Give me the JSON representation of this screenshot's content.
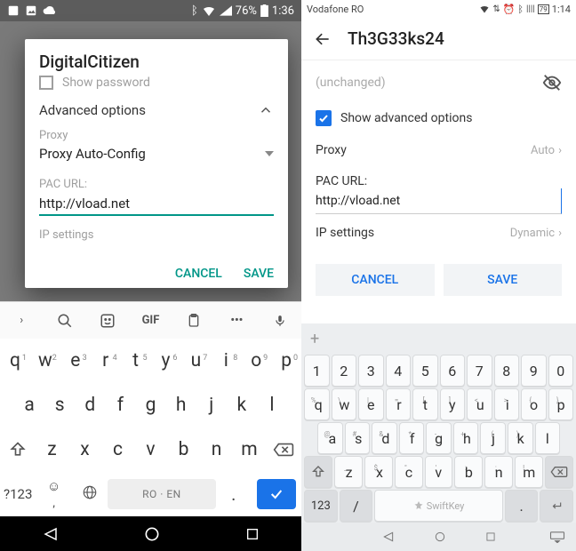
{
  "left": {
    "status": {
      "battery_pct": "76%",
      "time": "1:36"
    },
    "dialog": {
      "title": "DigitalCitizen",
      "show_password": "Show password",
      "advanced_options": "Advanced options",
      "proxy_label": "Proxy",
      "proxy_value": "Proxy Auto-Config",
      "pac_label": "PAC URL:",
      "pac_value": "http://vload.net",
      "ip_settings": "IP settings",
      "cancel": "CANCEL",
      "save": "SAVE"
    },
    "keyboard": {
      "gif": "GIF",
      "row1": [
        "q",
        "w",
        "e",
        "r",
        "t",
        "y",
        "u",
        "i",
        "o",
        "p"
      ],
      "row1_sup": [
        "1",
        "2",
        "3",
        "4",
        "5",
        "6",
        "7",
        "8",
        "9",
        "0"
      ],
      "row2": [
        "a",
        "s",
        "d",
        "f",
        "g",
        "h",
        "j",
        "k",
        "l"
      ],
      "row3": [
        "z",
        "x",
        "c",
        "v",
        "b",
        "n",
        "m"
      ],
      "sym": "?123",
      "space": "RO · EN",
      "comma": ",",
      "period": "."
    }
  },
  "right": {
    "status": {
      "carrier": "Vodafone RO",
      "battery_pct": "79",
      "time": "1:14"
    },
    "header_title": "Th3G33ks24",
    "unchanged": "(unchanged)",
    "show_advanced": "Show advanced options",
    "proxy_label": "Proxy",
    "proxy_value": "Auto",
    "pac_label": "PAC URL:",
    "pac_value": "http://vload.net",
    "ip_label": "IP settings",
    "ip_value": "Dynamic",
    "cancel": "CANCEL",
    "save": "SAVE",
    "keyboard": {
      "row_num": [
        "1",
        "2",
        "3",
        "4",
        "5",
        "6",
        "7",
        "8",
        "9",
        "0"
      ],
      "row1": [
        "q",
        "w",
        "e",
        "r",
        "t",
        "y",
        "u",
        "i",
        "o",
        "p"
      ],
      "row1_sup": [
        "%",
        "\\",
        "|",
        "=",
        "[",
        "]",
        "<",
        ">",
        "{",
        "}"
      ],
      "row2": [
        "a",
        "s",
        "d",
        "f",
        "g",
        "h",
        "j",
        "k",
        "l"
      ],
      "row2_sup": [
        "@",
        "#",
        "&",
        "*",
        "-",
        "+",
        "(",
        ")",
        ""
      ],
      "row3": [
        "z",
        "x",
        "c",
        "v",
        "b",
        "n",
        "m"
      ],
      "row3_sup": [
        "_",
        "$",
        "\"",
        "'",
        ":",
        ";",
        "!",
        "?"
      ],
      "sym": "123",
      "slash": "/",
      "space": "SwiftKey",
      "period": "."
    }
  }
}
